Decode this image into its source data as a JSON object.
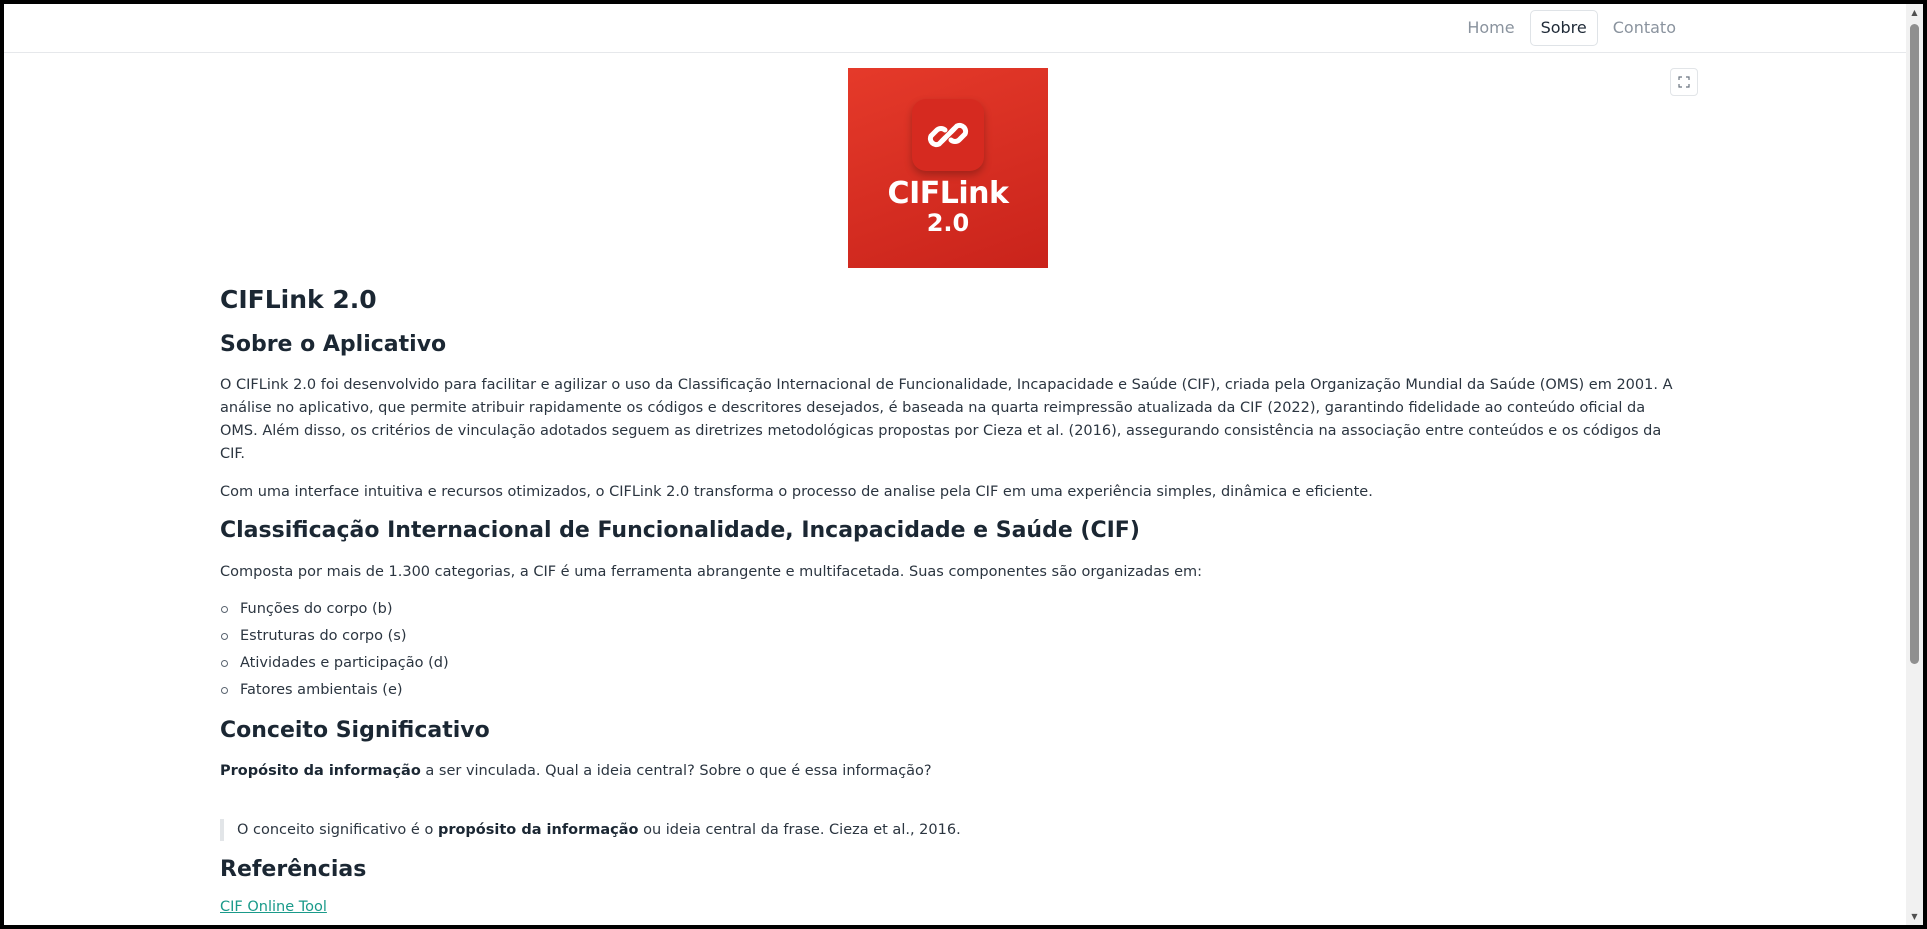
{
  "nav": {
    "items": [
      {
        "label": "Home",
        "active": false
      },
      {
        "label": "Sobre",
        "active": true
      },
      {
        "label": "Contato",
        "active": false
      }
    ]
  },
  "icons": {
    "fullscreen": "expand-icon",
    "logo": "chain-link-icon"
  },
  "logo": {
    "name": "CIFLink",
    "version": "2.0",
    "colors": {
      "background": "#d42a1f",
      "text": "#ffffff"
    }
  },
  "page": {
    "title": "CIFLink 2.0",
    "about": {
      "heading": "Sobre o Aplicativo",
      "paragraph1": "O CIFLink 2.0 foi desenvolvido para facilitar e agilizar o uso da Classificação Internacional de Funcionalidade, Incapacidade e Saúde (CIF), criada pela Organização Mundial da Saúde (OMS) em 2001. A análise no aplicativo, que permite atribuir rapidamente os códigos e descritores desejados, é baseada na quarta reimpressão atualizada da CIF (2022), garantindo fidelidade ao conteúdo oficial da OMS. Além disso, os critérios de vinculação adotados seguem as diretrizes metodológicas propostas por Cieza et al. (2016), assegurando consistência na associação entre conteúdos e os códigos da CIF.",
      "paragraph2": "Com uma interface intuitiva e recursos otimizados, o CIFLink 2.0 transforma o processo de analise pela CIF em uma experiência simples, dinâmica e eficiente."
    },
    "cif": {
      "heading": "Classificação Internacional de Funcionalidade, Incapacidade e Saúde (CIF)",
      "intro": "Composta por mais de 1.300 categorias, a CIF é uma ferramenta abrangente e multifacetada. Suas componentes são organizadas em:",
      "components": [
        "Funções do corpo (b)",
        "Estruturas do corpo (s)",
        "Atividades e participação (d)",
        "Fatores ambientais (e)"
      ]
    },
    "concept": {
      "heading": "Conceito Significativo",
      "strong": "Propósito da informação",
      "rest": " a ser vinculada. Qual a ideia central? Sobre o que é essa informação?",
      "quote_before": "O conceito significativo é o ",
      "quote_strong": "propósito da informação",
      "quote_after": " ou ideia central da frase. Cieza et al., 2016."
    },
    "references": {
      "heading": "Referências",
      "link_label": "CIF Online Tool"
    }
  },
  "colors": {
    "text": "#2b3540",
    "heading": "#1b2733",
    "link": "#1a9a8a",
    "nav_inactive": "#8a939e"
  }
}
